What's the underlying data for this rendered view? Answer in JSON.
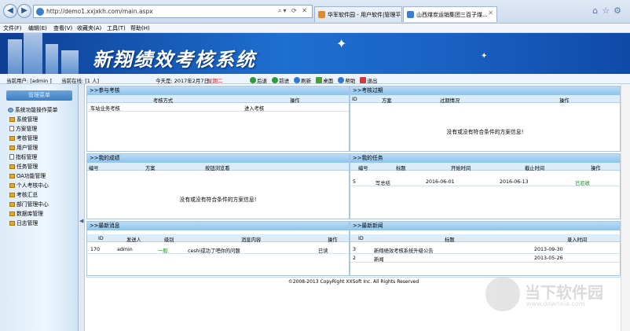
{
  "browser": {
    "url": "http://demo1.xxjxkh.com/main.aspx",
    "tabs": [
      {
        "label": "华军软件园 - 用户软件|管理平台"
      },
      {
        "label": "山西煤炭运销集团三百子煤..."
      }
    ],
    "menu": [
      "文件(F)",
      "编辑(E)",
      "查看(V)",
      "收藏夹(A)",
      "工具(T)",
      "帮助(H)"
    ]
  },
  "banner": {
    "title": "新翔绩效考核系统"
  },
  "status": {
    "user": "当前用户: [admin ]",
    "online": "当前在线: [1 人]",
    "today_label": "今天是: 2017年2月7日",
    "weekday": "星期二",
    "actions": [
      "后退",
      "前进",
      "刷新",
      "桌面",
      "帮助",
      "退出"
    ]
  },
  "sidebar": {
    "header": "管理菜单",
    "items": [
      "系统功能操作菜单",
      "系统管理",
      "方案管理",
      "考核管理",
      "用户管理",
      "指标管理",
      "任务管理",
      "OA功能管理",
      "个人考核中心",
      "考核汇总",
      "部门管理中心",
      "数据库管理",
      "日志管理"
    ]
  },
  "panels": {
    "assess": {
      "title": ">>参与考核",
      "columns": [
        "考核方式",
        "操作"
      ],
      "rows": [
        {
          "name": "车站业务考核",
          "action": "进入考核"
        }
      ]
    },
    "expired": {
      "title": ">>考核过期",
      "columns": [
        "ID",
        "方案",
        "过期情况",
        "操作"
      ],
      "empty": "没有或没有符合条件的方案信息!"
    },
    "scores": {
      "title": ">>我的成绩",
      "columns": [
        "编号",
        "方案",
        "按钮浏览看"
      ],
      "empty": "没有或没有符合条件的方案信息!"
    },
    "tasks": {
      "title": ">>我的任务",
      "columns": [
        "编号",
        "标题",
        "开始时间",
        "截止时间",
        "操作"
      ],
      "rows": [
        {
          "id": "5",
          "title": "写总结",
          "start": "2016-06-01",
          "end": "2016-06-13",
          "action": "已验收"
        }
      ]
    },
    "messages": {
      "title": ">>最新消息",
      "columns": [
        "ID",
        "发送人",
        "级别",
        "消息内容",
        "操作"
      ],
      "rows": [
        {
          "id": "170",
          "sender": "admin",
          "level": "一般",
          "content": "ceshi成功了吧你的问题",
          "action": "已读"
        }
      ]
    },
    "news": {
      "title": ">>最新新闻",
      "columns": [
        "ID",
        "标题",
        "录入时间"
      ],
      "rows": [
        {
          "id": "3",
          "title": "新翔绩效考核系统升级公告",
          "date": "2013-09-30"
        },
        {
          "id": "2",
          "title": "新闻",
          "date": "2013-05-26"
        }
      ]
    }
  },
  "footer": "©2008-2013 CopyRight XXSoft Inc.    All Rights Reserved",
  "watermark": {
    "title": "当下软件园",
    "url": "www.downxia.com"
  }
}
